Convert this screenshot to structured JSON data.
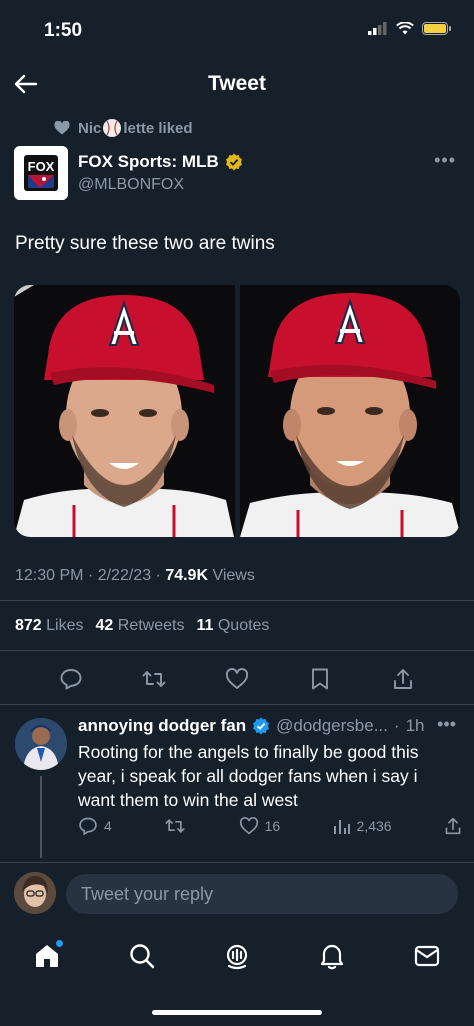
{
  "status_bar": {
    "time": "1:50"
  },
  "header": {
    "title": "Tweet"
  },
  "social_context": {
    "liked_text_prefix": "Nic",
    "liked_text_suffix": "lette liked"
  },
  "tweet": {
    "author_name": "FOX Sports: MLB",
    "author_handle": "@MLBONFOX",
    "logo_text": "FOX",
    "text": "Pretty sure these two are twins",
    "time": "12:30 PM",
    "date": "2/22/23",
    "views_count": "74.9K",
    "views_label": "Views",
    "likes_count": "872",
    "likes_label": "Likes",
    "retweets_count": "42",
    "retweets_label": "Retweets",
    "quotes_count": "11",
    "quotes_label": "Quotes"
  },
  "reply": {
    "author_name": "annoying dodger fan",
    "author_handle": "@dodgersbe...",
    "time": "1h",
    "text": "Rooting for the angels to finally be good this year, i speak for all dodger fans when i say i want them to win the al west",
    "reply_count": "4",
    "like_count": "16",
    "view_count": "2,436"
  },
  "compose": {
    "placeholder": "Tweet your reply"
  },
  "colors": {
    "background": "#15202b",
    "accent": "#1d9bf0",
    "verified_gold": "#e2b719",
    "cap_red": "#c8102e"
  },
  "icons": [
    "back-arrow-icon",
    "heart-icon",
    "baseball-icon",
    "verified-gold-icon",
    "verified-blue-icon",
    "reply-icon",
    "retweet-icon",
    "like-icon",
    "bookmark-icon",
    "share-icon",
    "views-icon",
    "home-icon",
    "search-icon",
    "spaces-icon",
    "bell-icon",
    "mail-icon"
  ]
}
